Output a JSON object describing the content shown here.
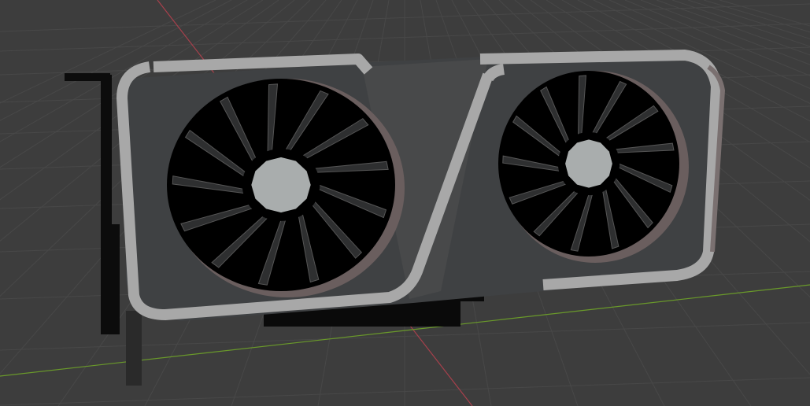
{
  "viewport": {
    "background": "#3d3d3d",
    "grid_color": "#4a4a4a",
    "x_axis_color": "#b04050",
    "y_axis_color": "#6a9a2a"
  },
  "gpu": {
    "shroud_color": "#3f4143",
    "frame_color": "#a8a8a8",
    "hub_color": "#a9adad",
    "blade_color": "#2e2f30",
    "fans": [
      {
        "name": "left-fan",
        "blade_count": 13
      },
      {
        "name": "right-fan",
        "blade_count": 13
      }
    ]
  }
}
